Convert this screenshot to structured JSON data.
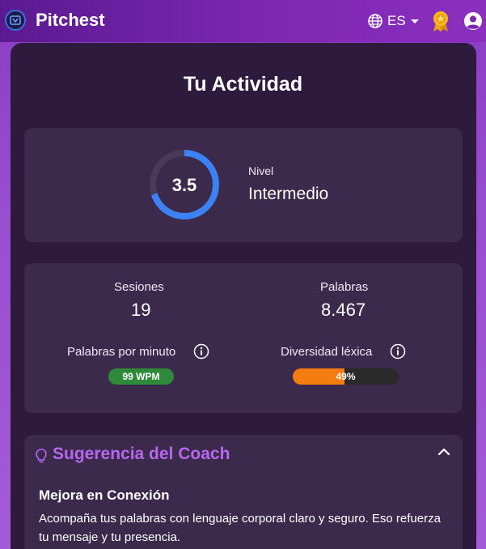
{
  "header": {
    "brand": "Pitchest",
    "language": "ES"
  },
  "main": {
    "title": "Tu Actividad",
    "level": {
      "score": "3.5",
      "label": "Nivel",
      "value": "Intermedio",
      "progress": 0.7
    },
    "stats": {
      "sessions_label": "Sesiones",
      "sessions_value": "19",
      "words_label": "Palabras",
      "words_value": "8.467",
      "wpm_label": "Palabras por minuto",
      "wpm_value": "99 WPM",
      "diversity_label": "Diversidad léxica",
      "diversity_value": "49%",
      "diversity_fraction": 0.49
    },
    "coach": {
      "title": "Sugerencia del Coach",
      "tip_title": "Mejora en Conexión",
      "tip_body": "Acompaña tus palabras con lenguaje corporal claro y seguro. Eso refuerza tu mensaje y tu presencia."
    }
  },
  "colors": {
    "gauge": "#3b82f6",
    "wpm_pill": "#2e8a3a",
    "diversity_fill": "#f47c10",
    "coach_accent": "#b667f0"
  }
}
